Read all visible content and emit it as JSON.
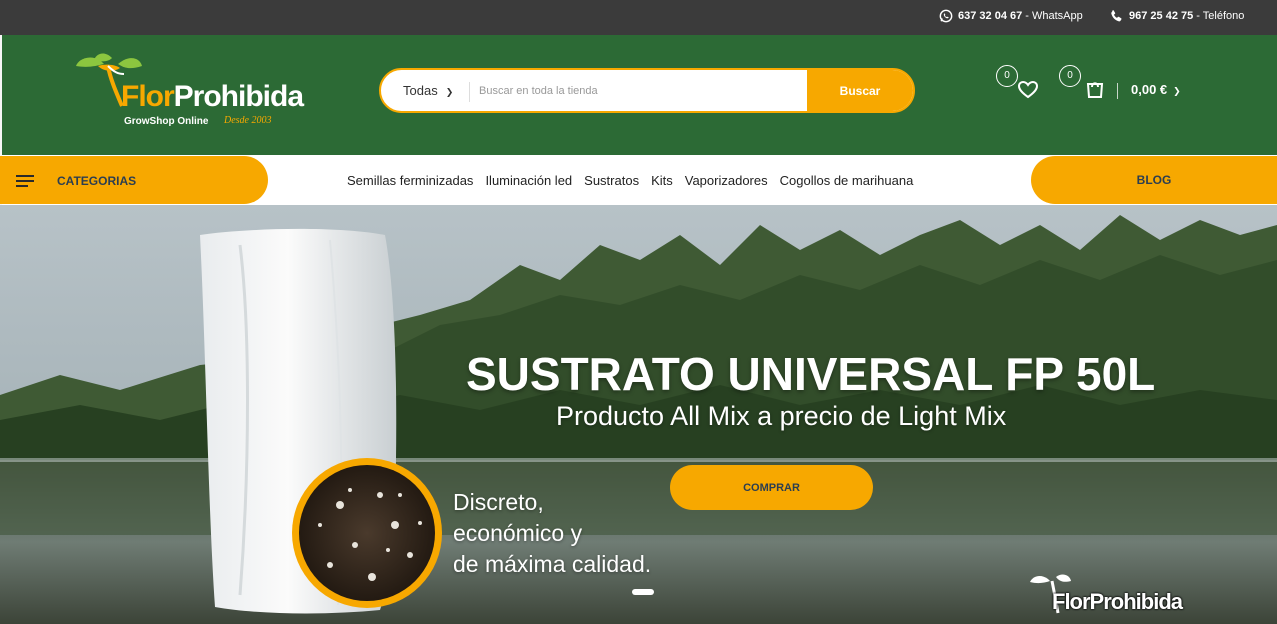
{
  "topbar": {
    "whatsapp_number": "637 32 04 67",
    "whatsapp_label": " - WhatsApp",
    "phone_number": "967 25 42 75",
    "phone_label": " - Teléfono"
  },
  "header": {
    "logo": {
      "part1": "Flor",
      "part2": "Prohibida",
      "tagline": "GrowShop Online",
      "since": "Desde 2003"
    },
    "search": {
      "category": "Todas",
      "placeholder": "Buscar en toda la tienda",
      "button": "Buscar"
    },
    "wishlist_count": "0",
    "cart_count": "0",
    "cart_total": "0,00 €"
  },
  "nav": {
    "categories_label": "CATEGORIAS",
    "links": [
      "Semillas ferminizadas",
      "Iluminación led",
      "Sustratos",
      "Kits",
      "Vaporizadores",
      "Cogollos de marihuana"
    ],
    "blog_label": "BLOG"
  },
  "hero": {
    "title": "SUSTRATO UNIVERSAL FP 50L",
    "subtitle": "Producto All Mix a precio de Light Mix",
    "button": "COMPRAR",
    "description": [
      "Discreto,",
      "económico y",
      "de máxima calidad."
    ],
    "watermark": "FlorProhibida"
  },
  "colors": {
    "accent": "#f7a800",
    "header_green": "#2c6a35",
    "topbar": "#3b3b3b"
  },
  "icons": {
    "whatsapp": "whatsapp-icon",
    "phone": "phone-icon",
    "wishlist": "heart-icon",
    "cart": "cart-icon",
    "menu": "hamburger-icon",
    "chevron": "chevron-down-icon"
  }
}
